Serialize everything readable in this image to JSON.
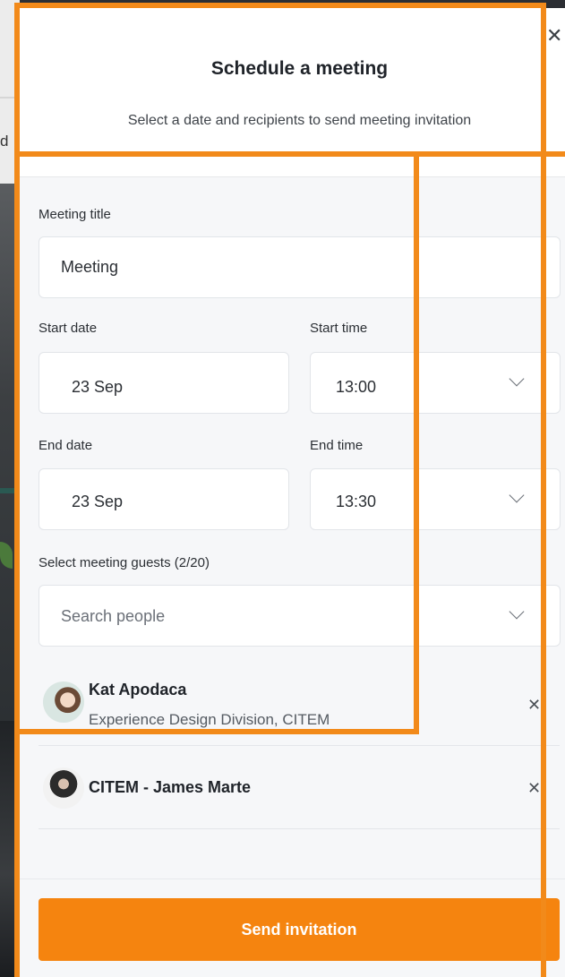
{
  "modal": {
    "title": "Schedule a meeting",
    "subtitle": "Select a date and recipients to send meeting invitation",
    "close_icon": "close-icon"
  },
  "form": {
    "meeting_title_label": "Meeting title",
    "meeting_title_value": "Meeting",
    "start_date_label": "Start date",
    "start_date_value": "23 Sep",
    "start_time_label": "Start time",
    "start_time_value": "13:00",
    "end_date_label": "End date",
    "end_date_value": "23 Sep",
    "end_time_label": "End time",
    "end_time_value": "13:30",
    "guests_label": "Select meeting guests (2/20)",
    "search_placeholder": "Search people"
  },
  "guests": [
    {
      "name": "Kat Apodaca",
      "subtitle": "Experience Design Division, CITEM"
    },
    {
      "name": "CITEM - James Marte",
      "subtitle": ""
    }
  ],
  "actions": {
    "send_label": "Send invitation"
  },
  "colors": {
    "accent": "#f5840f",
    "highlight": "#f28a1a"
  }
}
